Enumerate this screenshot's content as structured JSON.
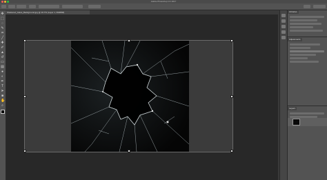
{
  "window": {
    "title": "Adobe Photoshop CC 2017"
  },
  "document": {
    "tab_label": "Shattered_Glass_Background.jpg @ 16.7% (Layer 1, RGB/8#)"
  },
  "toolbar": {
    "tools": [
      "move-icon",
      "marquee-icon",
      "lasso-icon",
      "quick-select-icon",
      "crop-icon",
      "eyedropper-icon",
      "healing-icon",
      "brush-icon",
      "stamp-icon",
      "history-brush-icon",
      "eraser-icon",
      "gradient-icon",
      "blur-icon",
      "dodge-icon",
      "pen-icon",
      "type-icon",
      "path-select-icon",
      "shape-icon",
      "hand-icon",
      "zoom-icon"
    ]
  },
  "panels": {
    "top_tab": "Libraries",
    "middle_tab": "Adjustments",
    "layers_tab": "Layers"
  },
  "colors": {
    "ui_dark": "#282828",
    "panel": "#535353",
    "photo_bg": "#0c0c0d"
  }
}
